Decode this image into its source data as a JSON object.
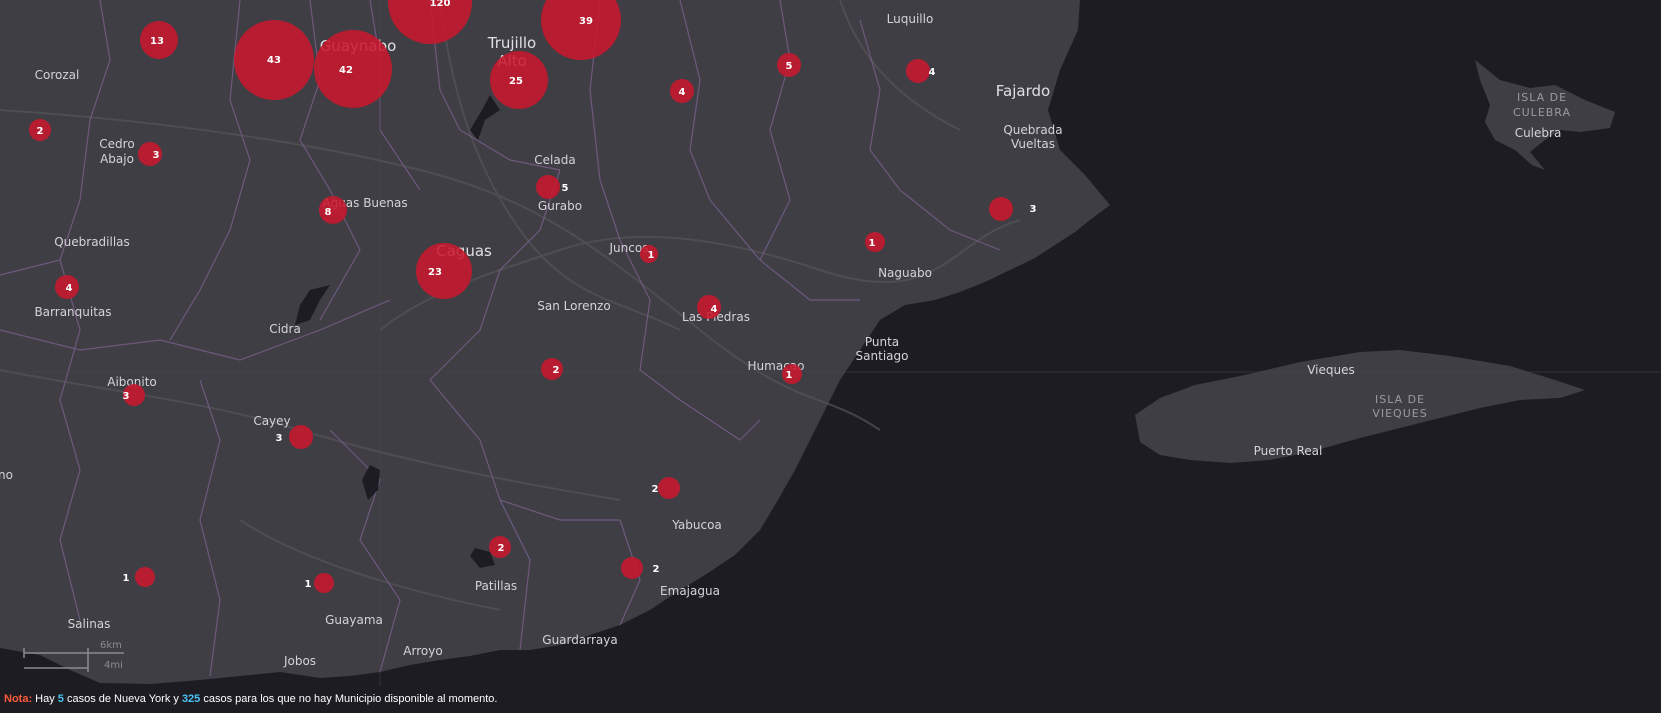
{
  "map": {
    "places": [
      {
        "id": "luquillo",
        "name": "Luquillo"
      },
      {
        "id": "fajardo",
        "name": "Fajardo"
      },
      {
        "id": "quebrada",
        "name": "Quebrada"
      },
      {
        "id": "vueltas",
        "name": "Vueltas"
      },
      {
        "id": "guaynabo",
        "name": "Guaynabo"
      },
      {
        "id": "trujillo",
        "name": "Trujillo"
      },
      {
        "id": "alto",
        "name": "Alto"
      },
      {
        "id": "corozal",
        "name": "Corozal"
      },
      {
        "id": "cedro",
        "name": "Cedro"
      },
      {
        "id": "abajo",
        "name": "Abajo"
      },
      {
        "id": "celada",
        "name": "Celada"
      },
      {
        "id": "gurabo",
        "name": "Gurabo"
      },
      {
        "id": "aguas-buenas",
        "name": "Aguas Buenas"
      },
      {
        "id": "caguas",
        "name": "Caguas"
      },
      {
        "id": "quebradillas",
        "name": "Quebradillas"
      },
      {
        "id": "juncos",
        "name": "Juncos"
      },
      {
        "id": "naguabo",
        "name": "Naguabo"
      },
      {
        "id": "barranquitas",
        "name": "Barranquitas"
      },
      {
        "id": "san-lorenzo",
        "name": "San Lorenzo"
      },
      {
        "id": "las-piedras",
        "name": "Las Piedras"
      },
      {
        "id": "cidra",
        "name": "Cidra"
      },
      {
        "id": "punta",
        "name": "Punta"
      },
      {
        "id": "santiago",
        "name": "Santiago"
      },
      {
        "id": "humacao",
        "name": "Humacao"
      },
      {
        "id": "aibonito",
        "name": "Aibonito"
      },
      {
        "id": "cayey",
        "name": "Cayey"
      },
      {
        "id": "vieques",
        "name": "Vieques"
      },
      {
        "id": "puerto-real",
        "name": "Puerto Real"
      },
      {
        "id": "yabucoa",
        "name": "Yabucoa"
      },
      {
        "id": "patillas",
        "name": "Patillas"
      },
      {
        "id": "emajagua",
        "name": "Emajagua"
      },
      {
        "id": "guayama",
        "name": "Guayama"
      },
      {
        "id": "salinas",
        "name": "Salinas"
      },
      {
        "id": "jobos",
        "name": "Jobos"
      },
      {
        "id": "arroyo",
        "name": "Arroyo"
      },
      {
        "id": "guardarraya",
        "name": "Guardarraya"
      },
      {
        "id": "culebra",
        "name": "Culebra"
      },
      {
        "id": "no",
        "name": "no"
      }
    ],
    "islands": [
      {
        "id": "isla-culebra-1",
        "name": "ISLA DE"
      },
      {
        "id": "isla-culebra-2",
        "name": "CULEBRA"
      },
      {
        "id": "isla-vieques-1",
        "name": "ISLA DE"
      },
      {
        "id": "isla-vieques-2",
        "name": "VIEQUES"
      }
    ],
    "markers": [
      {
        "id": "m120",
        "value": 120
      },
      {
        "id": "m39",
        "value": 39
      },
      {
        "id": "m43",
        "value": 43
      },
      {
        "id": "m42",
        "value": 42
      },
      {
        "id": "m25",
        "value": 25
      },
      {
        "id": "m13",
        "value": 13
      },
      {
        "id": "m23",
        "value": 23
      },
      {
        "id": "m8",
        "value": 8
      },
      {
        "id": "m5a",
        "value": 5
      },
      {
        "id": "m5b",
        "value": 5
      },
      {
        "id": "m4a",
        "value": 4
      },
      {
        "id": "m4b",
        "value": 4
      },
      {
        "id": "m4c",
        "value": 4
      },
      {
        "id": "m4d",
        "value": 4
      },
      {
        "id": "m3a",
        "value": 3
      },
      {
        "id": "m3b",
        "value": 3
      },
      {
        "id": "m3c",
        "value": 3
      },
      {
        "id": "m3d",
        "value": 3
      },
      {
        "id": "m2a",
        "value": 2
      },
      {
        "id": "m2b",
        "value": 2
      },
      {
        "id": "m2c",
        "value": 2
      },
      {
        "id": "m2d",
        "value": 2
      },
      {
        "id": "m2e",
        "value": 2
      },
      {
        "id": "m1a",
        "value": 1
      },
      {
        "id": "m1b",
        "value": 1
      },
      {
        "id": "m1c",
        "value": 1
      },
      {
        "id": "m1d",
        "value": 1
      },
      {
        "id": "m1e",
        "value": 1
      }
    ],
    "scale": {
      "km": "6km",
      "mi": "4mi"
    },
    "colors": {
      "land": "#3f3e44",
      "water": "#1d1c22",
      "marker": "#c8182e",
      "boundary": "#7a5f8c"
    }
  },
  "note": {
    "label": "Nota:",
    "text_1": " Hay ",
    "ny_count": "5",
    "text_2": " casos de Nueva York y ",
    "unknown_count": "325",
    "text_3": " casos para los que no hay Municipio disponible al momento."
  }
}
